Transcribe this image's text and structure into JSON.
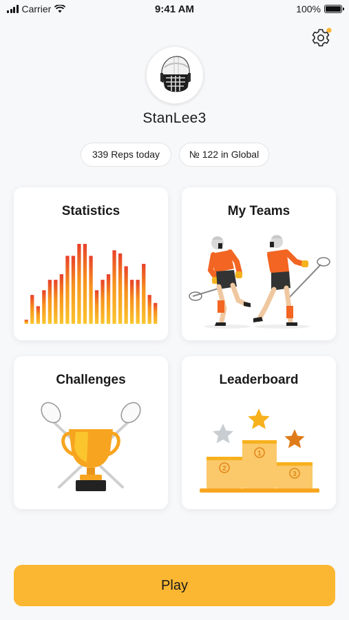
{
  "status_bar": {
    "carrier": "Carrier",
    "time": "9:41 AM",
    "battery": "100%"
  },
  "settings": {
    "icon": "gear-icon",
    "has_notification": true
  },
  "profile": {
    "username": "StanLee3",
    "avatar_icon": "lacrosse-helmet-icon"
  },
  "stats": {
    "reps": "339 Reps today",
    "rank": "№ 122 in Global"
  },
  "cards": {
    "statistics": {
      "title": "Statistics",
      "bar_levels": [
        0.05,
        0.36,
        0.22,
        0.42,
        0.55,
        0.55,
        0.62,
        0.85,
        0.85,
        1.0,
        1.0,
        0.85,
        0.42,
        0.55,
        0.62,
        0.92,
        0.88,
        0.72,
        0.55,
        0.55,
        0.75,
        0.36,
        0.26
      ]
    },
    "teams": {
      "title": "My Teams"
    },
    "challenges": {
      "title": "Challenges"
    },
    "leaderboard": {
      "title": "Leaderboard",
      "places": [
        "1",
        "2",
        "3"
      ]
    }
  },
  "colors": {
    "accent": "#fbb731",
    "orange": "#f26522",
    "gold": "#f7a520",
    "bronze": "#e07b1a",
    "silver": "#c8cdd2"
  },
  "play_button": {
    "label": "Play"
  }
}
